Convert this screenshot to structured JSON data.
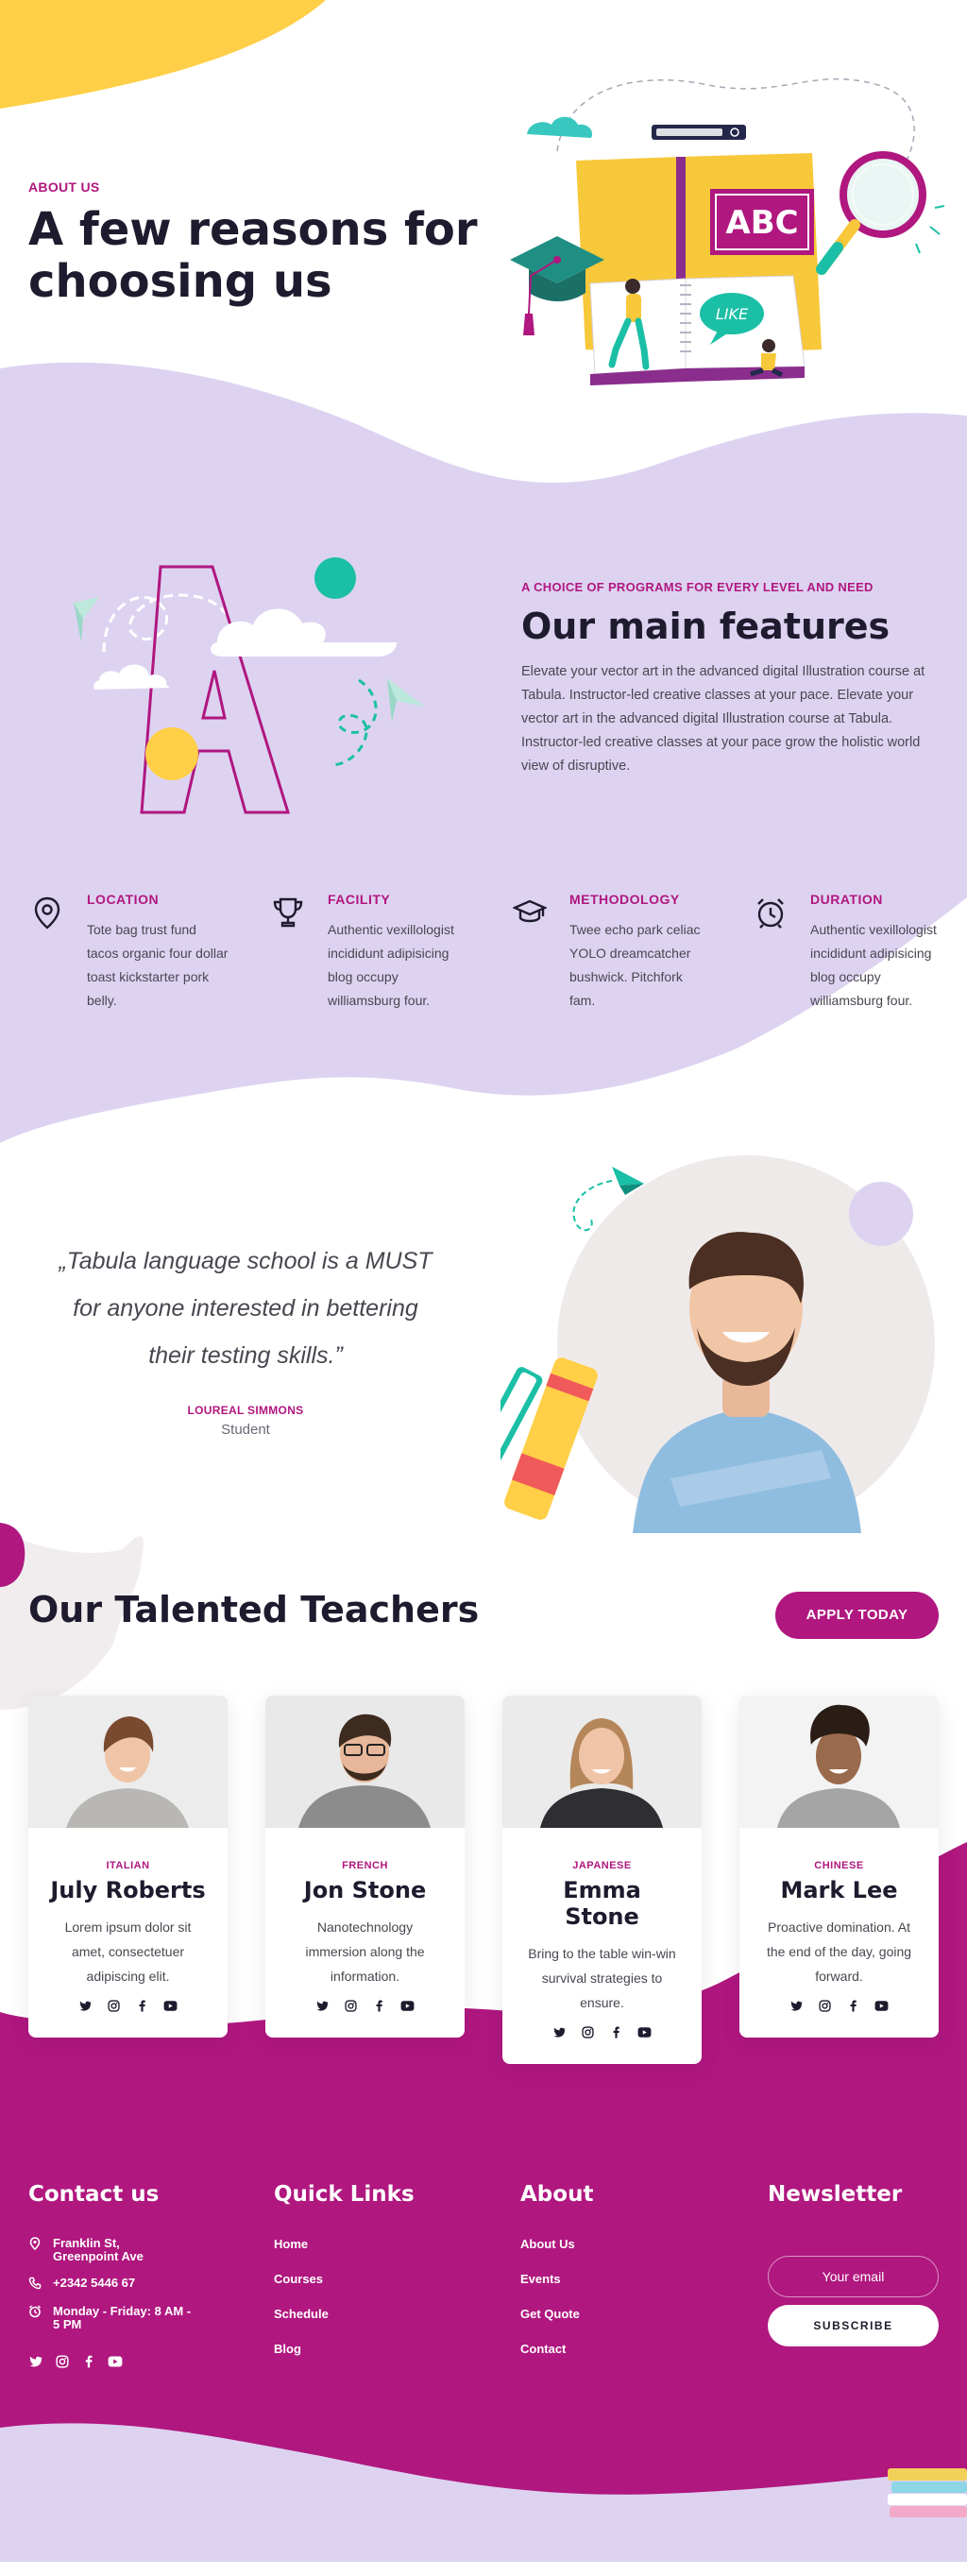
{
  "about": {
    "eyebrow": "ABOUT US",
    "title_line1": "A few reasons for",
    "title_line2": "choosing us"
  },
  "illustration": {
    "book_badge": "ABC",
    "bubble_text": "LIKE"
  },
  "features_intro": {
    "eyebrow": "A CHOICE OF PROGRAMS FOR EVERY LEVEL AND NEED",
    "title": "Our main features",
    "body": "Elevate your vector art in the advanced digital Illustration course at Tabula. Instructor-led creative classes at your pace. Elevate your vector art in the advanced digital Illustration course at Tabula. Instructor-led creative classes at your pace grow the holistic world view of disruptive."
  },
  "features": [
    {
      "title": "LOCATION",
      "text": "Tote bag trust fund tacos organic four dollar toast kickstarter pork belly.",
      "icon": "location-pin-icon"
    },
    {
      "title": "FACILITY",
      "text": "Authentic vexillologist incididunt adipisicing blog occupy williamsburg four.",
      "icon": "trophy-icon"
    },
    {
      "title": "METHODOLOGY",
      "text": "Twee echo park celiac YOLO dreamcatcher bushwick. Pitchfork fam.",
      "icon": "graduation-cap-icon"
    },
    {
      "title": "DURATION",
      "text": "Authentic vexillologist incididunt adipisicing blog occupy williamsburg four.",
      "icon": "alarm-clock-icon"
    }
  ],
  "testimonial": {
    "quote_line1": "„Tabula language school is a MUST",
    "quote_line2": "for anyone interested in bettering",
    "quote_line3": "their testing skills.”",
    "author": "LOUREAL SIMMONS",
    "role": "Student"
  },
  "teachers": {
    "title": "Our Talented Teachers",
    "apply_label": "APPLY TODAY",
    "items": [
      {
        "lang": "ITALIAN",
        "name": "July Roberts",
        "desc": "Lorem ipsum dolor sit amet, consectetuer adipiscing elit."
      },
      {
        "lang": "FRENCH",
        "name": "Jon Stone",
        "desc": "Nanotechnology immersion along the information."
      },
      {
        "lang": "JAPANESE",
        "name": "Emma Stone",
        "desc": "Bring to the table win-win survival strategies to ensure."
      },
      {
        "lang": "CHINESE",
        "name": "Mark Lee",
        "desc": "Proactive domination. At the end of the day, going forward."
      }
    ]
  },
  "footer": {
    "contact": {
      "title": "Contact us",
      "address": "Franklin St, Greenpoint Ave",
      "phone": "+2342 5446 67",
      "hours": "Monday - Friday: 8 AM - 5 PM"
    },
    "quick_links": {
      "title": "Quick Links",
      "items": [
        "Home",
        "Courses",
        "Schedule",
        "Blog"
      ]
    },
    "about": {
      "title": "About",
      "items": [
        "About Us",
        "Events",
        "Get Quote",
        "Contact"
      ]
    },
    "newsletter": {
      "title": "Newsletter",
      "placeholder": "Your email",
      "button": "SUBSCRIBE"
    }
  },
  "colors": {
    "brand": "#b0177f",
    "lavender": "#ddd3f1",
    "yellow": "#ffcf47",
    "teal": "#1bbfa6",
    "dark": "#1e1b2e"
  }
}
